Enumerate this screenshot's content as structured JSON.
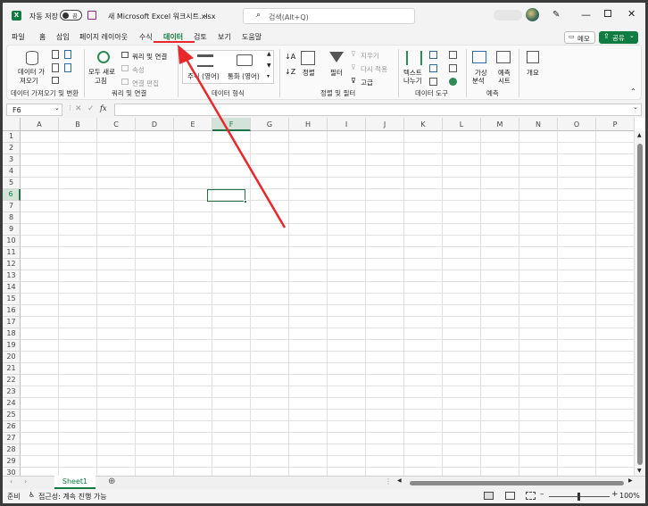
{
  "titlebar": {
    "autosave_label": "자동 저장",
    "toggle_state": "끔",
    "doc_title": "새 Microsoft Excel 워크시트.xlsx",
    "search_placeholder": "검색(Alt+Q)"
  },
  "tabs": [
    "파일",
    "홈",
    "삽입",
    "페이지 레이아웃",
    "수식",
    "데이터",
    "검토",
    "보기",
    "도움말"
  ],
  "active_tab": "데이터",
  "memo_label": "메모",
  "share_label": "공유",
  "ribbon": {
    "get_data": [
      "데이터 가",
      "져오기"
    ],
    "group1": "데이터 가져오기 및 변환",
    "refresh": [
      "모두 새로",
      "고침"
    ],
    "queries": "쿼리 및 연결",
    "props": "속성",
    "edit_links": "연결 편집",
    "group2": "쿼리 및 연결",
    "stocks": "주식 (영어)",
    "currency": "통화 (영어)",
    "group3": "데이터 형식",
    "sort": "정렬",
    "filter": "필터",
    "clear": "지우기",
    "reapply": "다시 적용",
    "advanced": "고급",
    "group4": "정렬 및 필터",
    "text_to_cols": [
      "텍스트",
      "나누기"
    ],
    "group5": "데이터 도구",
    "whatif": [
      "가상",
      "분석"
    ],
    "forecast": [
      "예측",
      "시트"
    ],
    "group6": "예측",
    "outline": "개요"
  },
  "formula_bar": {
    "name_box": "F6",
    "fx": "fx",
    "value": ""
  },
  "columns": [
    "A",
    "B",
    "C",
    "D",
    "E",
    "F",
    "G",
    "H",
    "I",
    "J",
    "K",
    "L",
    "M",
    "N",
    "O",
    "P"
  ],
  "rows": [
    "1",
    "2",
    "3",
    "4",
    "5",
    "6",
    "7",
    "8",
    "9",
    "10",
    "11",
    "12",
    "13",
    "14",
    "15",
    "16",
    "17",
    "18",
    "19",
    "20",
    "21",
    "22",
    "23",
    "24",
    "25",
    "26",
    "27",
    "28",
    "29",
    "30"
  ],
  "selected_cell": "F6",
  "sheet_tab": "Sheet1",
  "status": {
    "ready": "준비",
    "accessibility": "접근성: 계속 진행 가능",
    "zoom": "100%"
  },
  "colors": {
    "excel_green": "#107c41",
    "annotation_red": "#e8282b",
    "cell_selection": "#217346"
  }
}
